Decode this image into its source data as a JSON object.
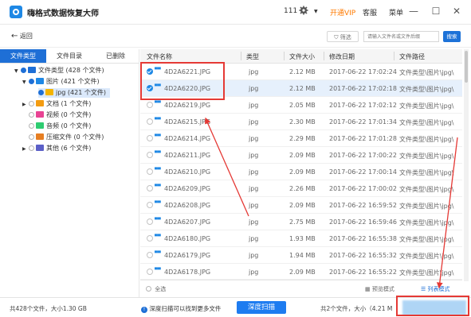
{
  "app": {
    "title": "嗨格式数据恢复大师",
    "user_id": "111",
    "vip_label": "开通VIP",
    "service_label": "客服",
    "menu_label": "菜单"
  },
  "toolbar": {
    "back_label": "返回",
    "filter_label": "筛选",
    "search_placeholder": "请输入文件名或文件后缀",
    "search_label": "搜索"
  },
  "left_tabs": [
    "文件类型",
    "文件目录",
    "已删除"
  ],
  "tree": [
    {
      "label": "文件类型 (428 个文件)",
      "color": "#1e6fd6"
    },
    {
      "label": "图片 (421 个文件)",
      "color": "#1e88e5"
    },
    {
      "label": "jpg (421 个文件)",
      "color": "#f4b400"
    },
    {
      "label": "文档 (1 个文件)",
      "color": "#f39c12"
    },
    {
      "label": "视频 (0 个文件)",
      "color": "#e84393"
    },
    {
      "label": "音频 (0 个文件)",
      "color": "#2ecc71"
    },
    {
      "label": "压缩文件 (0 个文件)",
      "color": "#e67e22"
    },
    {
      "label": "其他 (6 个文件)",
      "color": "#5b5fc7"
    }
  ],
  "table": {
    "headers": [
      "文件名称",
      "类型",
      "文件大小",
      "修改日期",
      "文件路径"
    ],
    "rows": [
      {
        "name": "4D2A6221.JPG",
        "type": "jpg",
        "size": "2.12 MB",
        "date": "2017-06-22 17:02:24",
        "path": "文件类型\\图片\\jpg\\",
        "checked": true
      },
      {
        "name": "4D2A6220.JPG",
        "type": "jpg",
        "size": "2.12 MB",
        "date": "2017-06-22 17:02:18",
        "path": "文件类型\\图片\\jpg\\",
        "checked": true
      },
      {
        "name": "4D2A6219.JPG",
        "type": "jpg",
        "size": "2.05 MB",
        "date": "2017-06-22 17:02:12",
        "path": "文件类型\\图片\\jpg\\",
        "checked": false
      },
      {
        "name": "4D2A6215.JPG",
        "type": "jpg",
        "size": "2.30 MB",
        "date": "2017-06-22 17:01:34",
        "path": "文件类型\\图片\\jpg\\",
        "checked": false
      },
      {
        "name": "4D2A6214.JPG",
        "type": "jpg",
        "size": "2.29 MB",
        "date": "2017-06-22 17:01:28",
        "path": "文件类型\\图片\\jpg\\",
        "checked": false
      },
      {
        "name": "4D2A6211.JPG",
        "type": "jpg",
        "size": "2.09 MB",
        "date": "2017-06-22 17:00:22",
        "path": "文件类型\\图片\\jpg\\",
        "checked": false
      },
      {
        "name": "4D2A6210.JPG",
        "type": "jpg",
        "size": "2.09 MB",
        "date": "2017-06-22 17:00:14",
        "path": "文件类型\\图片\\jpg\\",
        "checked": false
      },
      {
        "name": "4D2A6209.JPG",
        "type": "jpg",
        "size": "2.26 MB",
        "date": "2017-06-22 17:00:02",
        "path": "文件类型\\图片\\jpg\\",
        "checked": false
      },
      {
        "name": "4D2A6208.JPG",
        "type": "jpg",
        "size": "2.09 MB",
        "date": "2017-06-22 16:59:52",
        "path": "文件类型\\图片\\jpg\\",
        "checked": false
      },
      {
        "name": "4D2A6207.JPG",
        "type": "jpg",
        "size": "2.75 MB",
        "date": "2017-06-22 16:59:46",
        "path": "文件类型\\图片\\jpg\\",
        "checked": false
      },
      {
        "name": "4D2A6180.JPG",
        "type": "jpg",
        "size": "1.93 MB",
        "date": "2017-06-22 16:55:38",
        "path": "文件类型\\图片\\jpg\\",
        "checked": false
      },
      {
        "name": "4D2A6179.JPG",
        "type": "jpg",
        "size": "1.94 MB",
        "date": "2017-06-22 16:55:32",
        "path": "文件类型\\图片\\jpg\\",
        "checked": false
      },
      {
        "name": "4D2A6178.JPG",
        "type": "jpg",
        "size": "2.09 MB",
        "date": "2017-06-22 16:55:22",
        "path": "文件类型\\图片\\jpg\\",
        "checked": false
      }
    ],
    "select_all_label": "全选",
    "preview_mode_label": "预览模式",
    "list_mode_label": "列表模式"
  },
  "status": {
    "left_text": "共428个文件，大小1.30 GB",
    "deep_scan_tip": "深度扫描可以找到更多文件",
    "deep_scan_button": "深度扫描",
    "right_text": "共2个文件，大小（4.21 M"
  },
  "colors": {
    "accent": "#1e6fd6",
    "vip": "#ff7a00",
    "annotation_red": "#e53935"
  }
}
